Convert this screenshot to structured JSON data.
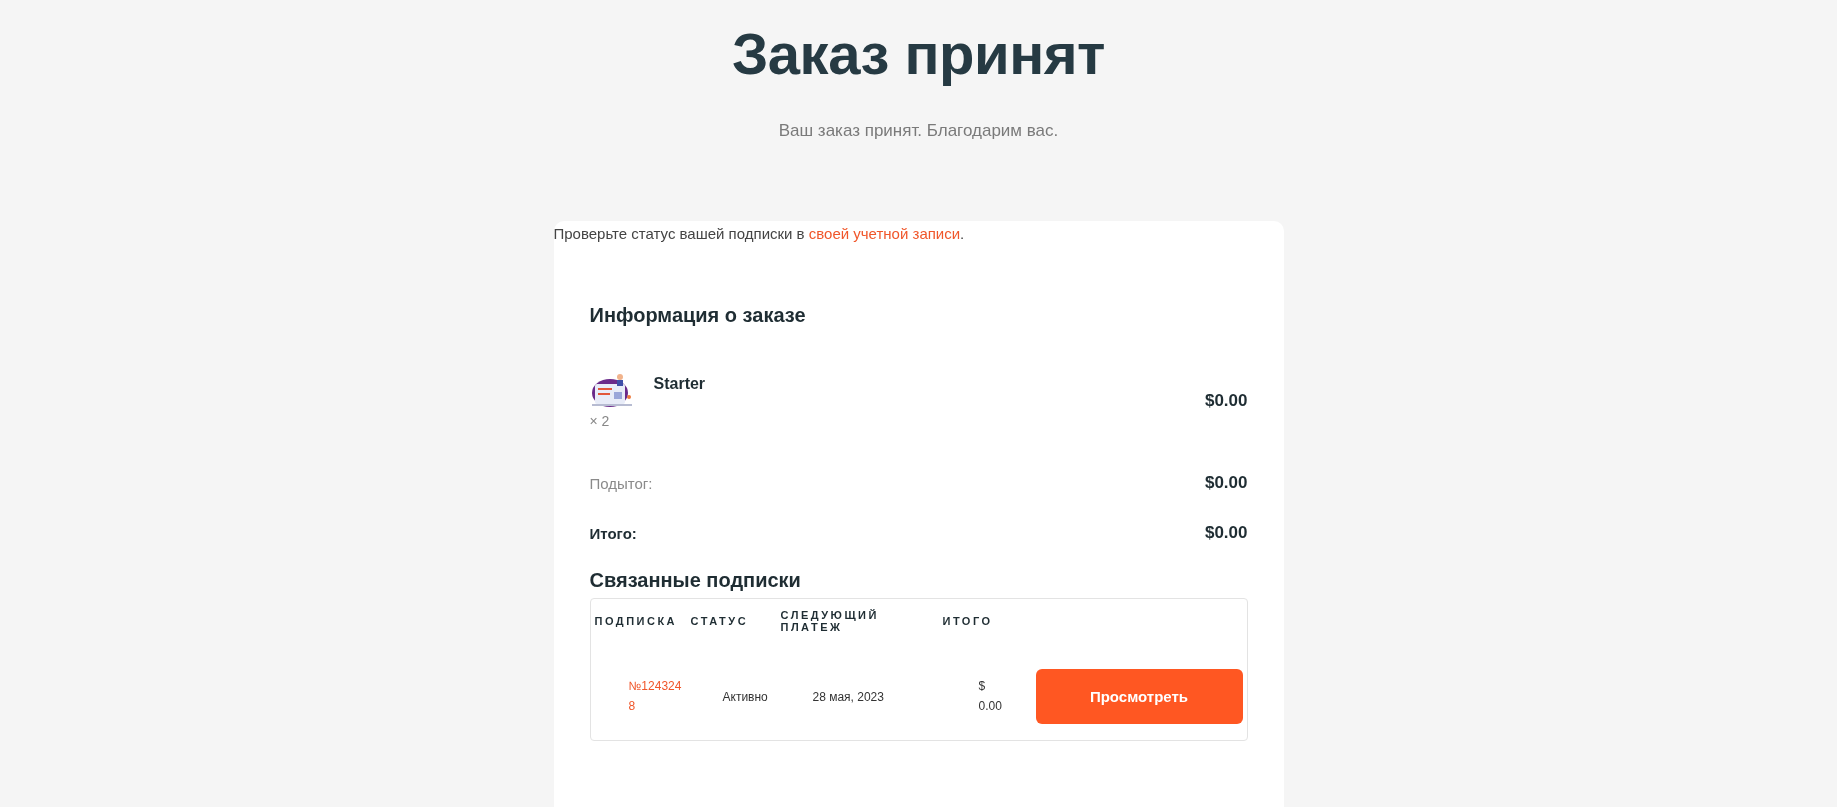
{
  "title": "Заказ принят",
  "subtitle": "Ваш заказ принят. Благодарим вас.",
  "notice": {
    "text": "Проверьте статус вашей подписки в ",
    "link": "своей учетной записи",
    "end": "."
  },
  "order": {
    "heading": "Информация о заказе",
    "item": {
      "kind": "picture",
      "name": "Starter",
      "quantity": "× 2",
      "price": "$0.00"
    },
    "totals": [
      {
        "kind": "subtotal",
        "label": "Подытог:",
        "value": "$0.00"
      },
      {
        "kind": "total",
        "label": "Итого:",
        "value": "$0.00"
      }
    ]
  },
  "subscriptions": {
    "heading": "Связанные подписки",
    "columns": [
      "ПОДПИСКА",
      "СТАТУС",
      "СЛЕДУЮЩИЙ ПЛАТЕЖ",
      "ИТОГО"
    ],
    "rows": [
      {
        "number": "№1243248",
        "status": "Активно",
        "next_payment": "28 мая, 2023",
        "total": "$ 0.00",
        "action": "Просмотреть"
      }
    ]
  }
}
